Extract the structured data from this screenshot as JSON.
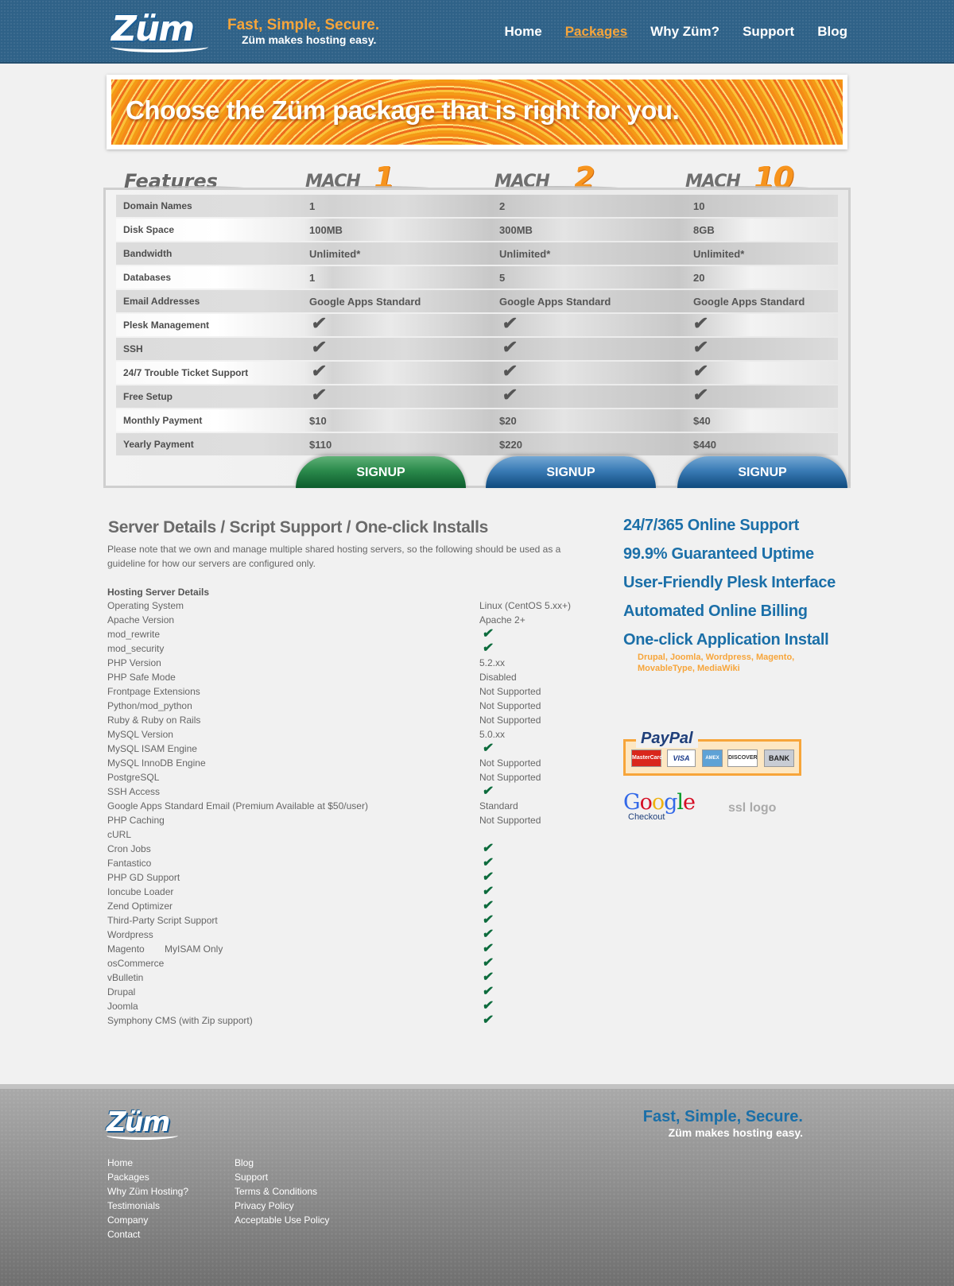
{
  "header": {
    "logo_text": "Züm",
    "tagline_main": "Fast, Simple, Secure.",
    "tagline_sub": "Züm makes hosting easy.",
    "nav": [
      "Home",
      "Packages",
      "Why Züm?",
      "Support",
      "Blog"
    ],
    "nav_active": "Packages"
  },
  "banner": {
    "headline": "Choose the Züm package that is right for you."
  },
  "packages": {
    "features_label": "Features",
    "plans": [
      {
        "prefix": "MACH",
        "number": "1"
      },
      {
        "prefix": "MACH",
        "number": "2"
      },
      {
        "prefix": "MACH",
        "number": "10"
      }
    ],
    "rows": [
      {
        "label": "Domain Names",
        "values": [
          "1",
          "2",
          "10"
        ]
      },
      {
        "label": "Disk Space",
        "values": [
          "100MB",
          "300MB",
          "8GB"
        ]
      },
      {
        "label": "Bandwidth",
        "values": [
          "Unlimited*",
          "Unlimited*",
          "Unlimited*"
        ]
      },
      {
        "label": "Databases",
        "values": [
          "1",
          "5",
          "20"
        ]
      },
      {
        "label": "Email Addresses",
        "values": [
          "Google Apps Standard",
          "Google Apps Standard",
          "Google Apps Standard"
        ]
      },
      {
        "label": "Plesk Management",
        "values": [
          "✔",
          "✔",
          "✔"
        ]
      },
      {
        "label": "SSH",
        "values": [
          "✔",
          "✔",
          "✔"
        ]
      },
      {
        "label": "24/7 Trouble Ticket Support",
        "values": [
          "✔",
          "✔",
          "✔"
        ]
      },
      {
        "label": "Free Setup",
        "values": [
          "✔",
          "✔",
          "✔"
        ]
      },
      {
        "label": "Monthly Payment",
        "values": [
          "$10",
          "$20",
          "$40"
        ]
      },
      {
        "label": "Yearly Payment",
        "values": [
          "$110",
          "$220",
          "$440"
        ]
      }
    ],
    "signup_label": "SIGNUP",
    "signup_colors": [
      "#2b8a4c",
      "#3a7bb5",
      "#3a7bb5"
    ]
  },
  "server": {
    "title": "Server Details / Script Support / One-click Installs",
    "note": "Please note that we own and manage multiple shared hosting servers, so the following should be used as a guideline for how our servers are configured only.",
    "section_heading": "Hosting Server Details",
    "specs": [
      {
        "k": "Operating System",
        "v": "Linux (CentOS 5.xx+)"
      },
      {
        "k": "Apache Version",
        "v": "Apache 2+"
      },
      {
        "k": "mod_rewrite",
        "v": "✔"
      },
      {
        "k": "mod_security",
        "v": "✔"
      },
      {
        "k": "PHP Version",
        "v": "5.2.xx"
      },
      {
        "k": "PHP Safe Mode",
        "v": "Disabled"
      },
      {
        "k": "Frontpage Extensions",
        "v": "Not Supported"
      },
      {
        "k": "Python/mod_python",
        "v": "Not Supported"
      },
      {
        "k": "Ruby & Ruby on Rails",
        "v": "Not Supported"
      },
      {
        "k": "MySQL Version",
        "v": "5.0.xx"
      },
      {
        "k": "MySQL ISAM Engine",
        "v": "✔"
      },
      {
        "k": "MySQL InnoDB Engine",
        "v": "Not Supported"
      },
      {
        "k": "PostgreSQL",
        "v": "Not Supported"
      },
      {
        "k": "SSH Access",
        "v": "✔"
      },
      {
        "k": "Google Apps Standard Email (Premium Available at $50/user)",
        "v": "Standard"
      },
      {
        "k": "PHP Caching",
        "v": "Not Supported"
      },
      {
        "k": "cURL",
        "v": ""
      },
      {
        "k": "Cron Jobs",
        "v": "✔"
      },
      {
        "k": "Fantastico",
        "v": "✔"
      },
      {
        "k": "PHP GD Support",
        "v": "✔"
      },
      {
        "k": "Ioncube Loader",
        "v": "✔"
      },
      {
        "k": "Zend Optimizer",
        "v": "✔"
      },
      {
        "k": "Third-Party Script Support",
        "v": "✔"
      },
      {
        "k": "Wordpress",
        "v": "✔"
      },
      {
        "k": "Magento",
        "k2": "MyISAM Only",
        "v": "✔"
      },
      {
        "k": "osCommerce",
        "v": "✔"
      },
      {
        "k": "vBulletin",
        "v": "✔"
      },
      {
        "k": "Drupal",
        "v": "✔"
      },
      {
        "k": "Joomla",
        "v": "✔"
      },
      {
        "k": "Symphony CMS (with Zip support)",
        "v": "✔"
      }
    ]
  },
  "highlights": {
    "items": [
      "24/7/365 Online Support",
      "99.9% Guaranteed Uptime",
      "User-Friendly Plesk Interface",
      "Automated Online Billing",
      "One-click Application Install"
    ],
    "apps_note": "Drupal, Joomla, Wordpress, Magento, MovableType, MediaWiki"
  },
  "payments": {
    "paypal": "PayPal",
    "cards": [
      "MasterCard",
      "VISA",
      "AMEX",
      "DISCOVER",
      "BANK"
    ],
    "google_checkout_word": "Google",
    "google_checkout_sub": "Checkout",
    "ssl_logo": "ssl logo"
  },
  "footer": {
    "logo_text": "Züm",
    "tagline_main": "Fast, Simple, Secure.",
    "tagline_sub": "Züm makes hosting easy.",
    "col1": [
      "Home",
      "Packages",
      "Why Züm Hosting?",
      "Testimonials",
      "Company",
      "Contact"
    ],
    "col2": [
      "Blog",
      "Support",
      "Terms & Conditions",
      "Privacy Policy",
      "Acceptable Use Policy"
    ]
  },
  "colors": {
    "brand_blue": "#2f6288",
    "accent_orange": "#f7a53a",
    "check_green": "#0c6b3c",
    "highlight_blue": "#1b6fa8"
  }
}
